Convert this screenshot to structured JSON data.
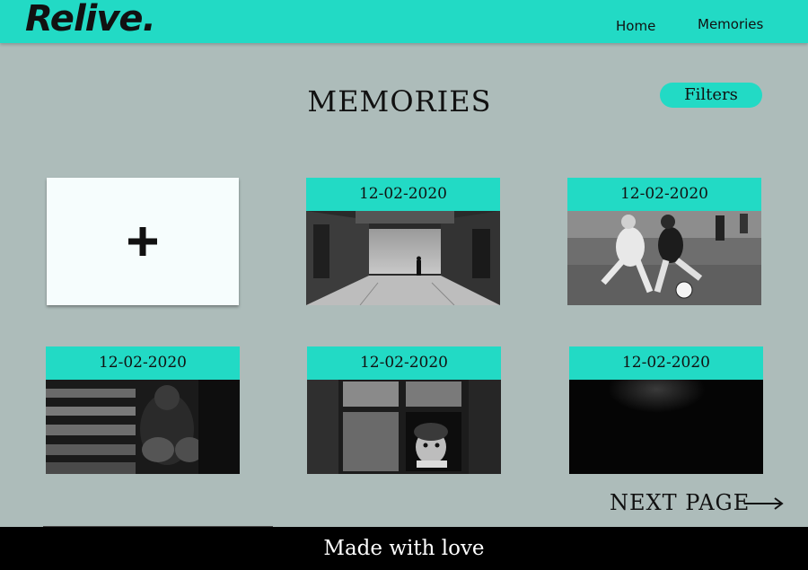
{
  "header": {
    "logo": "Relive.",
    "nav": {
      "home": "Home",
      "memories": "Memories"
    }
  },
  "main": {
    "title": "MEMORIES",
    "filters_label": "Filters",
    "add_icon": "plus-icon",
    "cards": [
      {
        "date": "12-02-2020",
        "photo": "alley-with-walking-person"
      },
      {
        "date": "12-02-2020",
        "photo": "soccer-players-kicking-ball"
      },
      {
        "date": "12-02-2020",
        "photo": "child-sitting-on-steps"
      },
      {
        "date": "12-02-2020",
        "photo": "child-peeking-through-window"
      },
      {
        "date": "12-02-2020",
        "photo": "dark-silhouette"
      }
    ],
    "next_page": "NEXT PAGE",
    "next_icon": "arrow-right-icon"
  },
  "footer": {
    "text": "Made with love"
  },
  "colors": {
    "accent": "#22dac5",
    "background": "#adbcba",
    "footer": "#000000",
    "card_blank": "#f6fdfd"
  }
}
